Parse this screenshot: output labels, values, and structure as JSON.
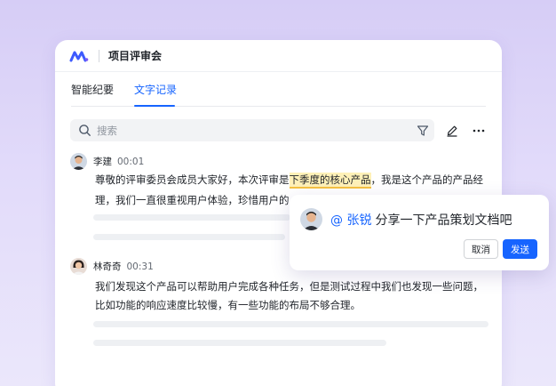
{
  "header": {
    "title": "项目评审会",
    "logo_icon": "meeting-logo-icon"
  },
  "tabs": [
    {
      "label": "智能纪要",
      "active": false
    },
    {
      "label": "文字记录",
      "active": true
    }
  ],
  "search": {
    "placeholder": "搜索"
  },
  "toolbar": {
    "icons": [
      "filter-icon",
      "edit-icon",
      "more-icon"
    ]
  },
  "transcript": [
    {
      "speaker": "李建",
      "time": "00:01",
      "lines": [
        {
          "before": "尊敬的评审委员会成员大家好，本次评审是",
          "highlight": "下季度的核心产品",
          "after": "，我是这个产品的产品经"
        },
        {
          "text": "理，我们一直很重视用户体验，珍惜用户的"
        }
      ]
    },
    {
      "speaker": "林奇奇",
      "time": "00:31",
      "lines": [
        {
          "text": "我们发现这个产品可以帮助用户完成各种任务，但是测试过程中我们也发现一些问题，"
        },
        {
          "text": "比如功能的响应速度比较慢，有一些功能的布局不够合理。"
        }
      ]
    }
  ],
  "popup": {
    "mention": "@ 张锐",
    "message": "分享一下产品策划文档吧",
    "cancel_label": "取消",
    "send_label": "发送"
  },
  "colors": {
    "accent": "#1664ff",
    "highlight_bg": "#fff1b8",
    "highlight_border": "#f5c242"
  }
}
